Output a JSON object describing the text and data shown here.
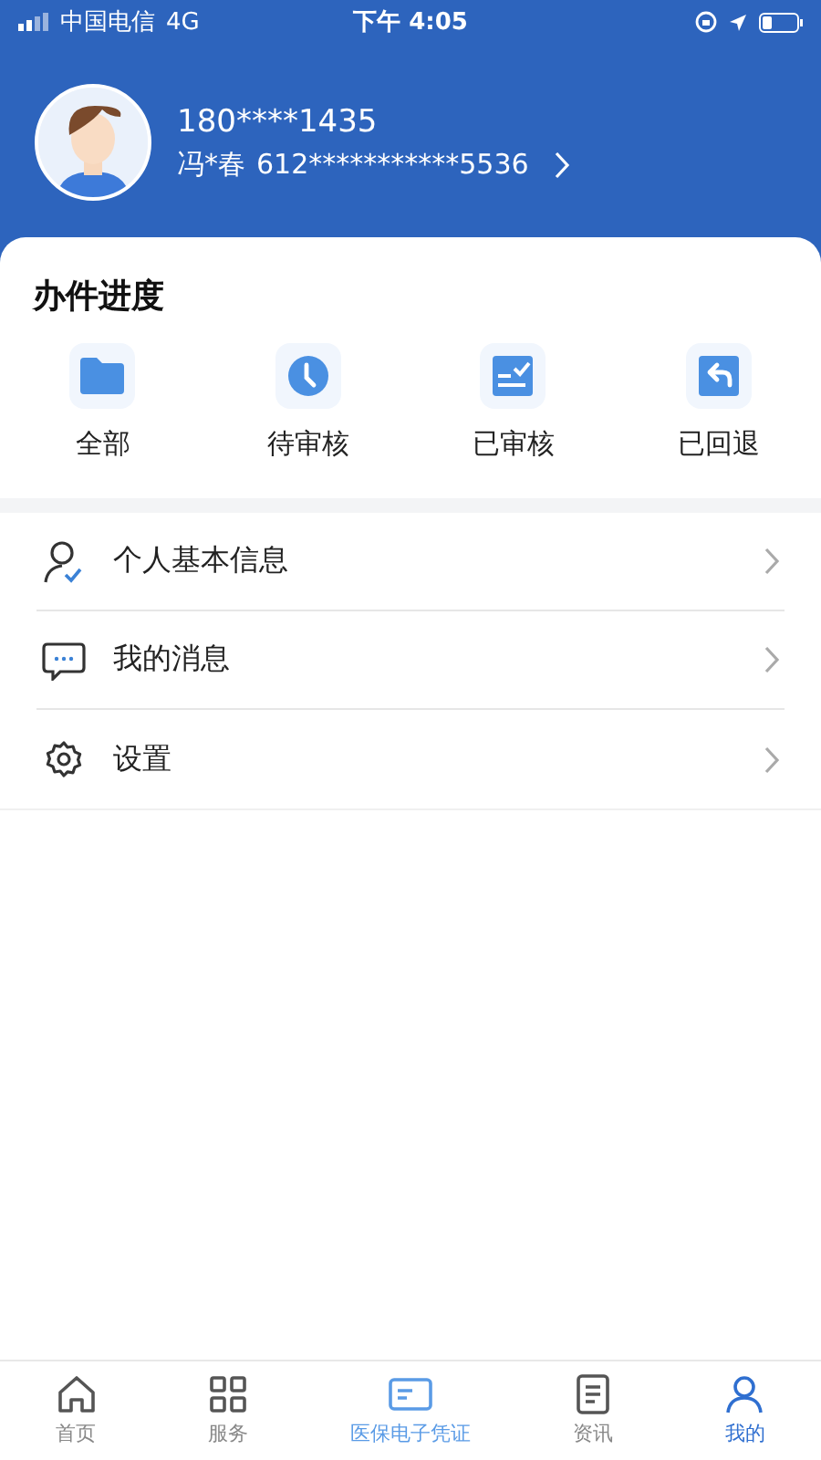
{
  "status_bar": {
    "carrier": "中国电信",
    "network": "4G",
    "time": "下午 4:05"
  },
  "profile": {
    "phone": "180****1435",
    "name": "冯*春",
    "id_number": "612***********5536"
  },
  "progress": {
    "title": "办件进度",
    "items": [
      {
        "kind": "folder",
        "label": "全部"
      },
      {
        "kind": "clock",
        "label": "待审核"
      },
      {
        "kind": "checklist",
        "label": "已审核"
      },
      {
        "kind": "return",
        "label": "已回退"
      }
    ]
  },
  "menu": [
    {
      "kind": "person",
      "label": "个人基本信息"
    },
    {
      "kind": "message",
      "label": "我的消息"
    },
    {
      "kind": "settings",
      "label": "设置"
    }
  ],
  "tab_bar": [
    {
      "kind": "home",
      "label": "首页",
      "selected": false
    },
    {
      "kind": "service",
      "label": "服务",
      "selected": false
    },
    {
      "kind": "card",
      "label": "医保电子凭证",
      "selected": false
    },
    {
      "kind": "news",
      "label": "资讯",
      "selected": false
    },
    {
      "kind": "me",
      "label": "我的",
      "selected": true
    }
  ]
}
